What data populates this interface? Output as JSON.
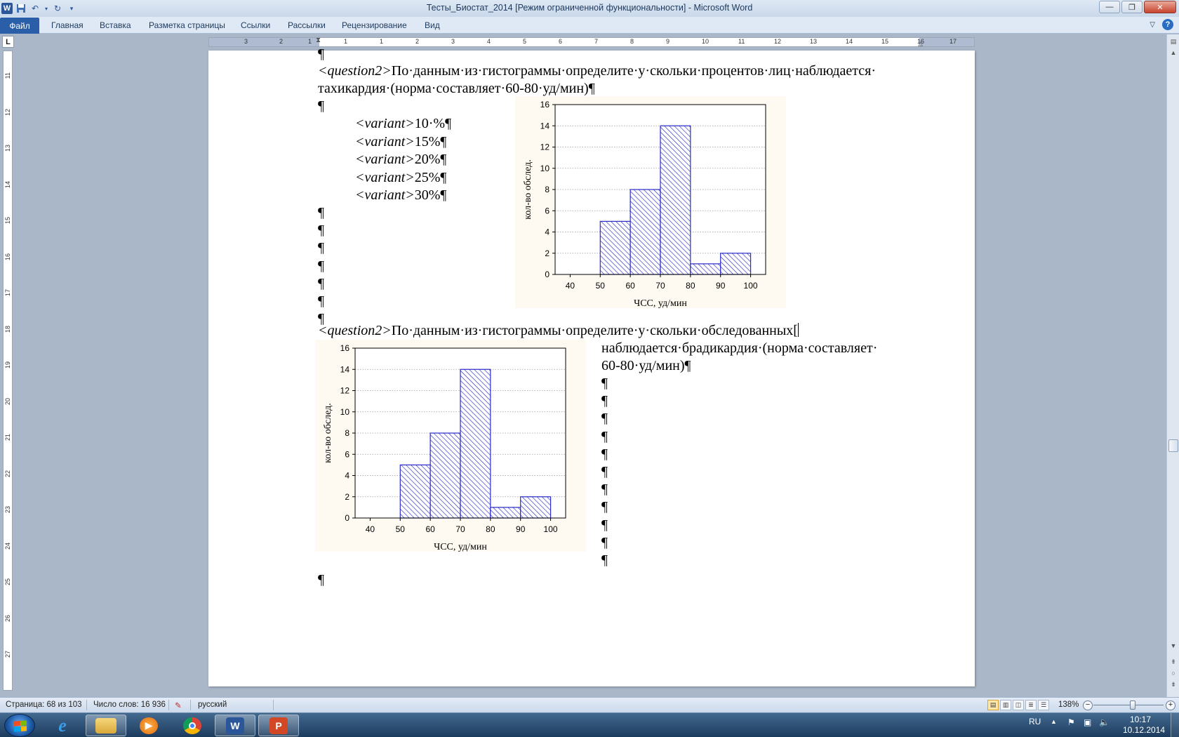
{
  "window": {
    "title": "Тесты_Биостат_2014 [Режим ограниченной функциональности]  -  Microsoft Word",
    "controls": {
      "minimize": "—",
      "maximize": "❐",
      "close": "✕"
    }
  },
  "quick_access": {
    "app_icon": "W",
    "save_icon": "floppy-icon",
    "undo_icon": "undo-icon",
    "redo_icon": "redo-icon",
    "customize_icon": "dropdown-icon"
  },
  "ribbon": {
    "file_tab": "Файл",
    "tabs": [
      "Главная",
      "Вставка",
      "Разметка страницы",
      "Ссылки",
      "Рассылки",
      "Рецензирование",
      "Вид"
    ]
  },
  "ruler": {
    "corner": "L",
    "h_numbers": [
      "3",
      "2",
      "1",
      "1",
      "1",
      "2",
      "3",
      "4",
      "5",
      "6",
      "7",
      "8",
      "9",
      "10",
      "11",
      "12",
      "13",
      "14",
      "15",
      "16",
      "17"
    ],
    "v_numbers": [
      "11",
      "12",
      "13",
      "14",
      "15",
      "16",
      "17",
      "18",
      "19",
      "20",
      "21",
      "22",
      "23",
      "24",
      "25",
      "26",
      "27"
    ]
  },
  "document": {
    "pilcrow": "¶",
    "q1": {
      "tag": "<question2>",
      "line1": "По·данным·из·гистограммы·определите·у·скольки·процентов·лиц·наблюдается·",
      "line2": "тахикардия·(норма·составляет·60-80·уд/мин)¶"
    },
    "variants": [
      {
        "tag": "<variant>",
        "value": "10·%¶"
      },
      {
        "tag": "<variant>",
        "value": "15%¶"
      },
      {
        "tag": "<variant>",
        "value": "20%¶"
      },
      {
        "tag": "<variant>",
        "value": "25%¶"
      },
      {
        "tag": "<variant>",
        "value": "30%¶"
      }
    ],
    "q2": {
      "tag": "<question2>",
      "line1": "По·данным·из·гистограммы·определите·у·скольки·обследованных[",
      "line2": "наблюдается·брадикардия·(норма·составляет·",
      "line3": "60-80·уд/мин)¶"
    }
  },
  "chart_data": [
    {
      "type": "bar",
      "subtype": "histogram",
      "bins": [
        [
          40,
          50
        ],
        [
          50,
          60
        ],
        [
          60,
          70
        ],
        [
          70,
          80
        ],
        [
          80,
          90
        ],
        [
          90,
          100
        ]
      ],
      "values": [
        0,
        5,
        8,
        14,
        1,
        2
      ],
      "xlabel": "ЧСС, уд/мин",
      "ylabel": "кол-во обслед.",
      "xticks": [
        "40",
        "50",
        "60",
        "70",
        "80",
        "90",
        "100"
      ],
      "yticks": [
        "0",
        "2",
        "4",
        "6",
        "8",
        "10",
        "12",
        "14",
        "16"
      ],
      "xlim": [
        35,
        105
      ],
      "ylim": [
        0,
        16
      ],
      "grid": "horizontal dotted",
      "bar_color": "#2b2bc8"
    },
    {
      "type": "bar",
      "subtype": "histogram",
      "bins": [
        [
          40,
          50
        ],
        [
          50,
          60
        ],
        [
          60,
          70
        ],
        [
          70,
          80
        ],
        [
          80,
          90
        ],
        [
          90,
          100
        ]
      ],
      "values": [
        0,
        5,
        8,
        14,
        1,
        2
      ],
      "xlabel": "ЧСС, уд/мин",
      "ylabel": "кол-во обслед.",
      "xticks": [
        "40",
        "50",
        "60",
        "70",
        "80",
        "90",
        "100"
      ],
      "yticks": [
        "0",
        "2",
        "4",
        "6",
        "8",
        "10",
        "12",
        "14",
        "16"
      ],
      "xlim": [
        35,
        105
      ],
      "ylim": [
        0,
        16
      ],
      "grid": "horizontal dotted",
      "bar_color": "#2b2bc8"
    }
  ],
  "status_bar": {
    "page": "Страница: 68 из 103",
    "words": "Число слов: 16 936",
    "language": "русский",
    "zoom": "138%",
    "zoom_minus": "−",
    "zoom_plus": "+"
  },
  "taskbar": {
    "lang": "RU",
    "time": "10:17",
    "date": "10.12.2014",
    "apps": [
      "explorer",
      "internet-explorer",
      "media-player",
      "chrome",
      "word",
      "powerpoint"
    ]
  }
}
